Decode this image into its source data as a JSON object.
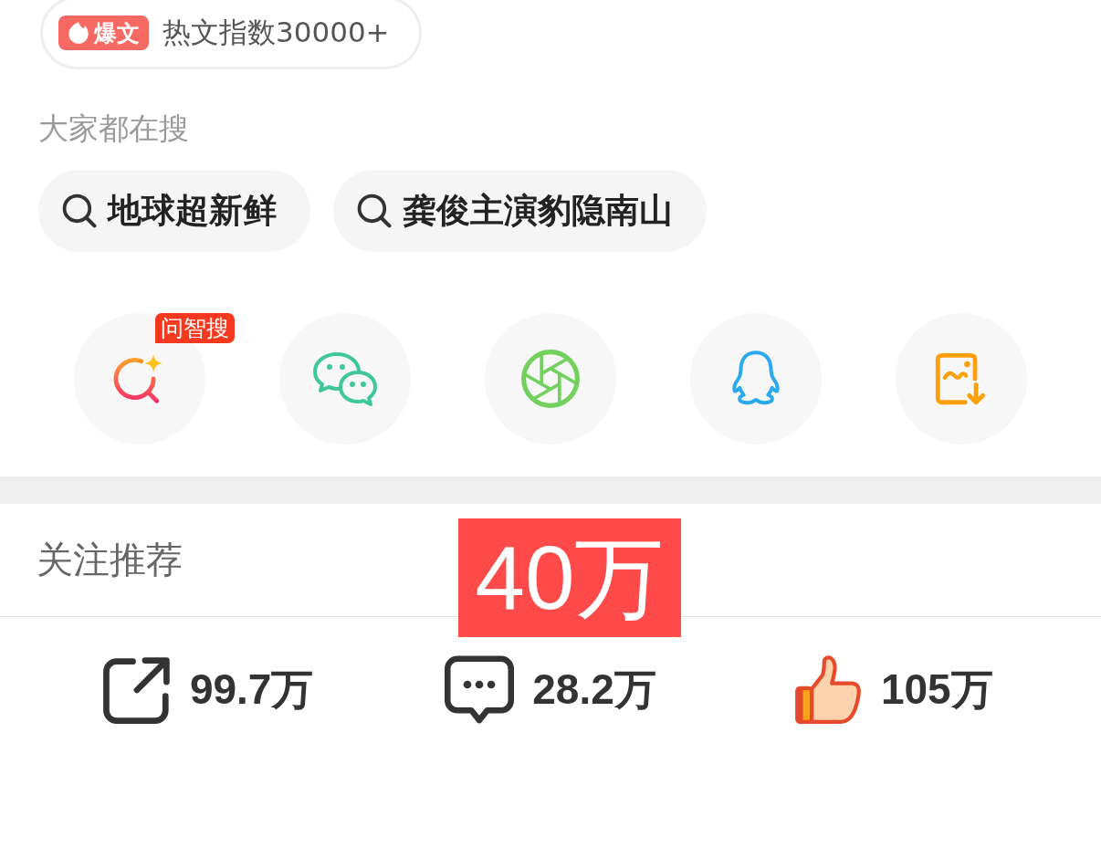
{
  "hot_index": {
    "badge": "爆文",
    "text": "热文指数30000+"
  },
  "trending": {
    "title": "大家都在搜",
    "items": [
      "地球超新鲜",
      "龚俊主演豹隐南山"
    ]
  },
  "share_targets": [
    {
      "kind": "ai-search",
      "badge": "问智搜"
    },
    {
      "kind": "chat"
    },
    {
      "kind": "aperture"
    },
    {
      "kind": "penguin"
    },
    {
      "kind": "image-download"
    }
  ],
  "follow_section": {
    "title": "关注推荐"
  },
  "overlay_label": {
    "text": "40万"
  },
  "stats": [
    {
      "kind": "share",
      "count": "99.7万"
    },
    {
      "kind": "comment",
      "count": "28.2万"
    },
    {
      "kind": "like",
      "count": "105万"
    }
  ]
}
